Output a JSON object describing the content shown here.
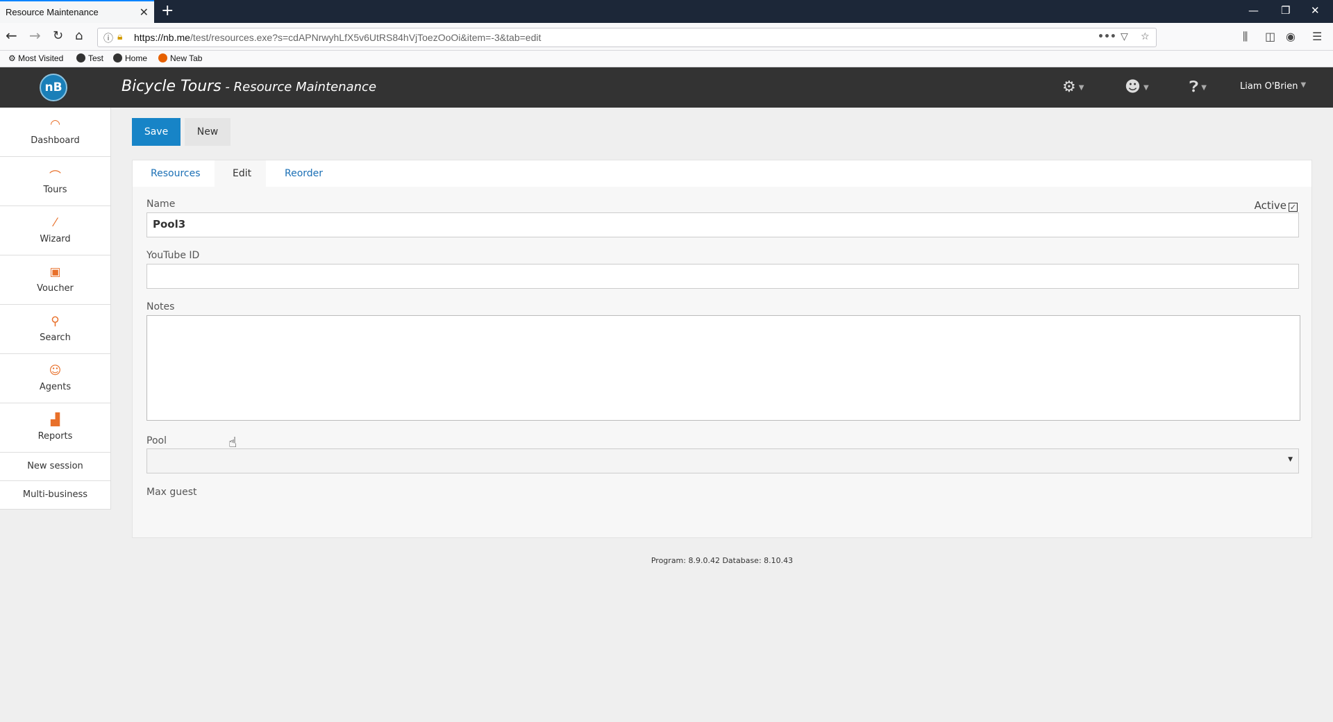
{
  "browser": {
    "tab_title": "Resource Maintenance",
    "url_host": "https://nb.me",
    "url_path": "/test/resources.exe?s=cdAPNrwyhLfX5v6UtRS84hVjToezOoOi&item=-3&tab=edit",
    "bookmarks": [
      "Most Visited",
      "Test",
      "Home",
      "New Tab"
    ]
  },
  "header": {
    "logo": "nB",
    "title": "Bicycle Tours",
    "subtitle": " - Resource Maintenance",
    "user": "Liam O'Brien"
  },
  "sidebar": {
    "items": [
      {
        "label": "Dashboard",
        "icon": "gauge-icon"
      },
      {
        "label": "Tours",
        "icon": "hanger-icon"
      },
      {
        "label": "Wizard",
        "icon": "wand-icon"
      },
      {
        "label": "Voucher",
        "icon": "gift-icon"
      },
      {
        "label": "Search",
        "icon": "search-icon"
      },
      {
        "label": "Agents",
        "icon": "agent-icon"
      },
      {
        "label": "Reports",
        "icon": "chart-icon"
      }
    ],
    "links": [
      "New session",
      "Multi-business"
    ]
  },
  "toolbar": {
    "save_label": "Save",
    "new_label": "New"
  },
  "tabs": [
    "Resources",
    "Edit",
    "Reorder"
  ],
  "form": {
    "name_label": "Name",
    "name_value": "Pool3",
    "active_label": "Active",
    "youtube_label": "YouTube ID",
    "youtube_value": "",
    "notes_label": "Notes",
    "notes_value": "",
    "pool_label": "Pool",
    "pool_value": "",
    "max_guest_label": "Max guest"
  },
  "footer": {
    "version": "Program: 8.9.0.42 Database: 8.10.43"
  }
}
